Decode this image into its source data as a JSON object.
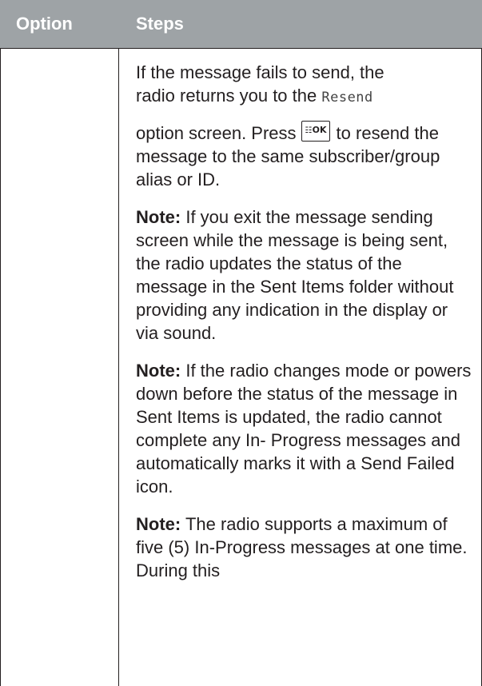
{
  "table": {
    "headers": {
      "option": "Option",
      "steps": "Steps"
    }
  },
  "steps": {
    "p1_line1": "If the message fails to send, the",
    "p1_line2_pre": "radio returns you to the ",
    "p1_ui_text": "Resend",
    "p2_pre": "option screen. Press",
    "p2_key_icon": "menu-ok-key-icon",
    "p2_key_glyph": "☷",
    "p2_key_label": "OK",
    "p2_post": "to resend the message to the same subscriber/group alias or ID.",
    "note1_label": "Note:",
    "note1_text": "If you exit the message sending screen while the message is being sent, the radio updates the status of the message in the Sent Items folder without providing any indication in the display or via sound.",
    "note2_label": "Note:",
    "note2_text": "If the radio changes mode or powers down before the status of the message in Sent Items is updated, the radio cannot complete any In- Progress messages and automatically marks it with a Send Failed icon.",
    "note3_label": "Note:",
    "note3_text": "The radio supports a maximum of five (5) In-Progress messages at one time. During this"
  },
  "colors": {
    "header_bg": "#9ea3a6",
    "header_text": "#ffffff",
    "body_text": "#231f20",
    "rule": "#231f20"
  }
}
